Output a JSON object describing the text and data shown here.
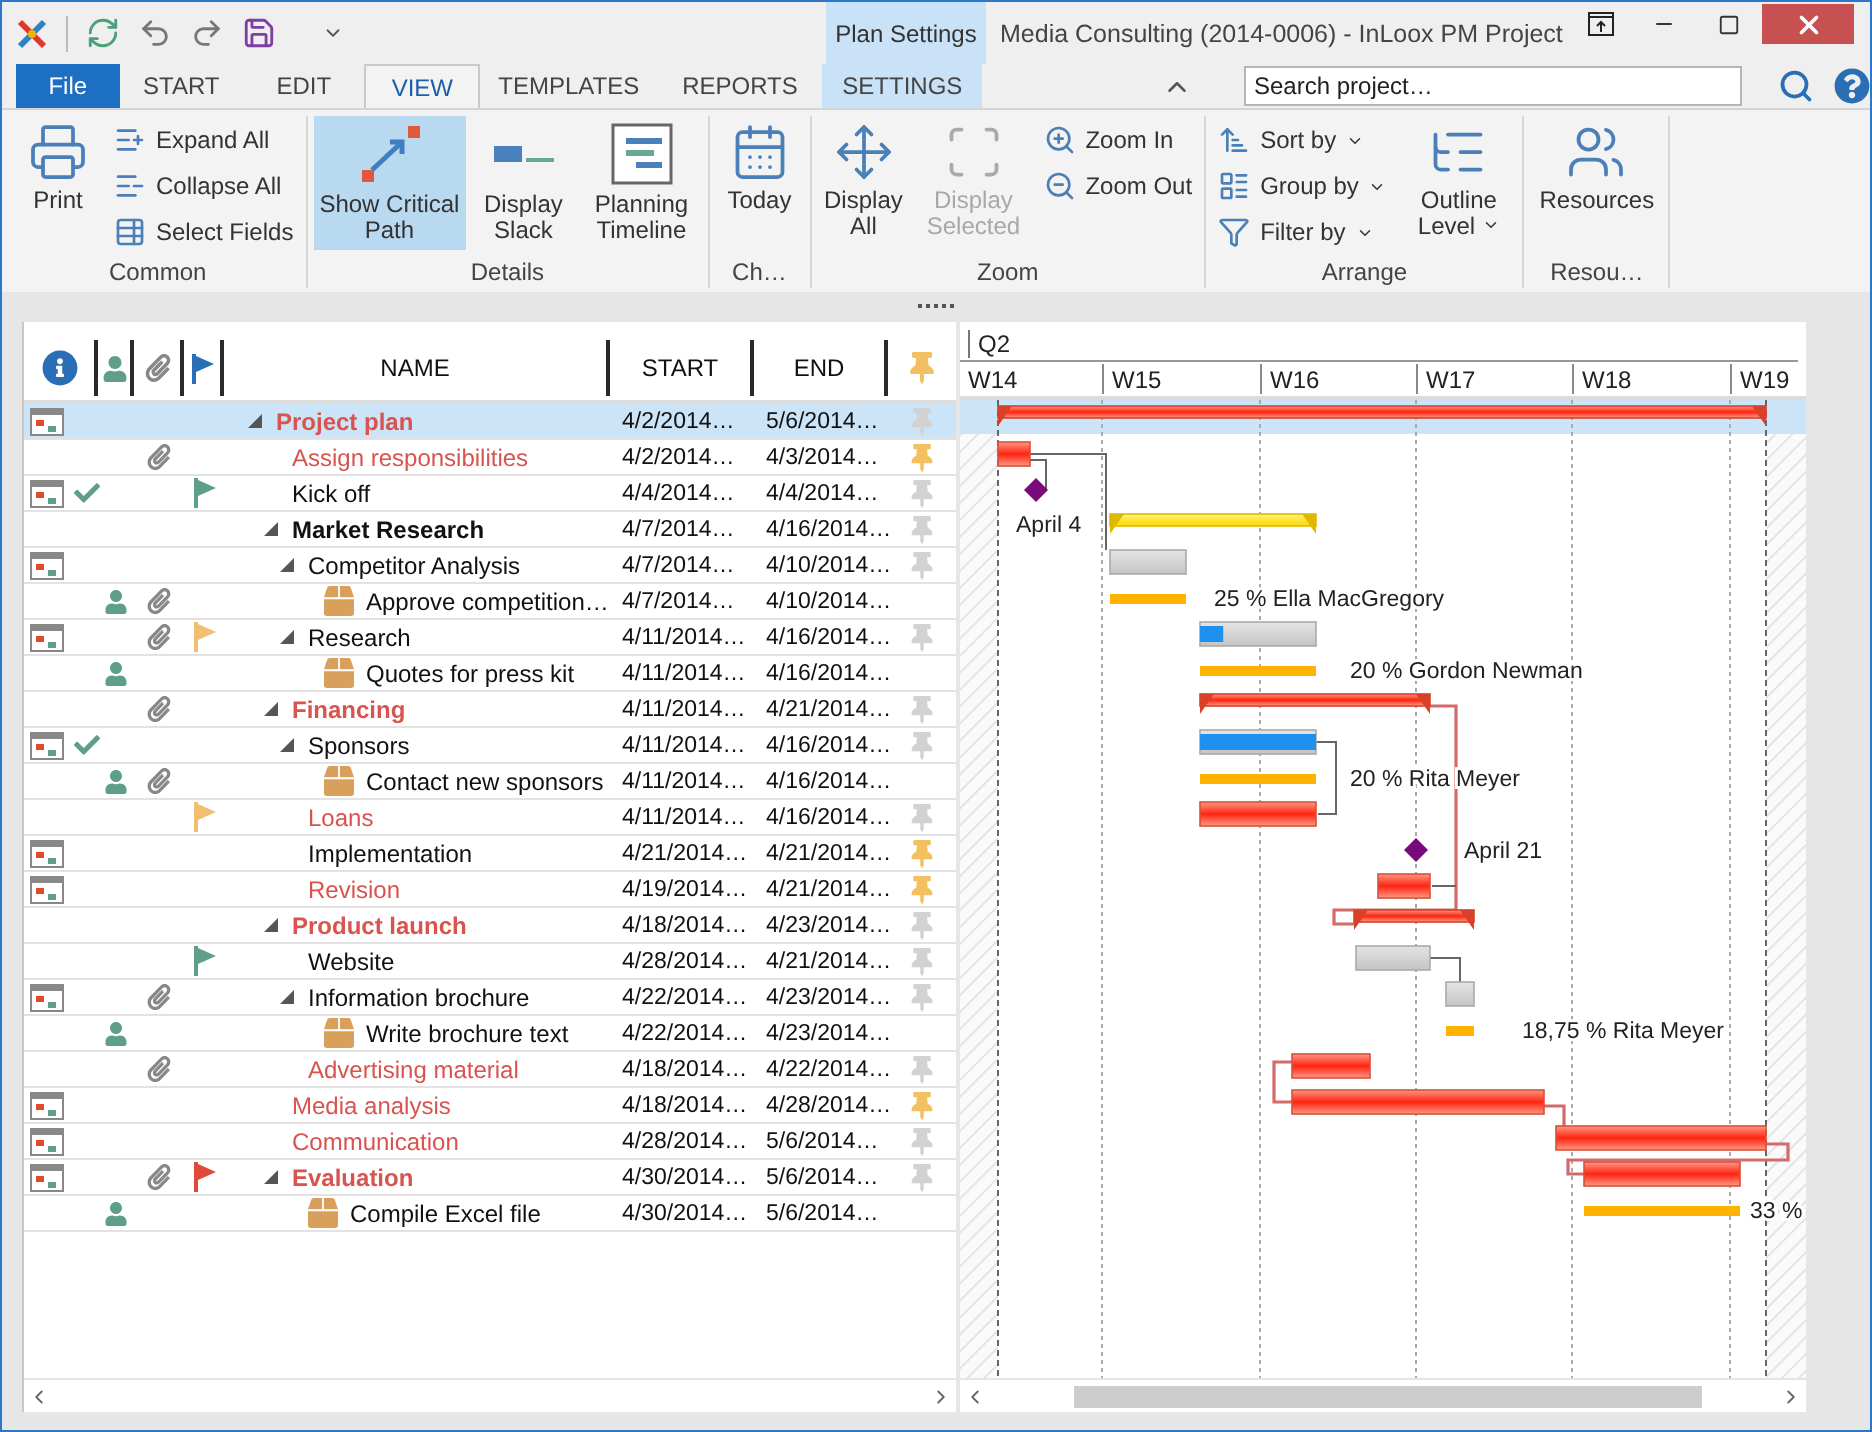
{
  "window": {
    "title": "Media Consulting (2014-0006) - InLoox PM Project",
    "context_header": "Plan Settings"
  },
  "tabs": [
    {
      "label": "File",
      "kind": "file",
      "selected": false
    },
    {
      "label": "START",
      "kind": "normal",
      "selected": false
    },
    {
      "label": "EDIT",
      "kind": "normal",
      "selected": false
    },
    {
      "label": "VIEW",
      "kind": "normal",
      "selected": true
    },
    {
      "label": "TEMPLATES",
      "kind": "normal",
      "selected": false
    },
    {
      "label": "REPORTS",
      "kind": "normal",
      "selected": false
    },
    {
      "label": "SETTINGS",
      "kind": "context",
      "selected": false
    }
  ],
  "search": {
    "placeholder": "Search project…"
  },
  "ribbon": {
    "groups": [
      {
        "label": "Common",
        "items": [
          {
            "label": "Print",
            "kind": "large",
            "selected": false,
            "disabled": false,
            "dropdown": false
          },
          {
            "label": "Expand All",
            "kind": "small",
            "selected": false,
            "disabled": false,
            "dropdown": false
          },
          {
            "label": "Collapse All",
            "kind": "small",
            "selected": false,
            "disabled": false,
            "dropdown": false
          },
          {
            "label": "Select Fields",
            "kind": "small",
            "selected": false,
            "disabled": false,
            "dropdown": false
          }
        ]
      },
      {
        "label": "Details",
        "items": [
          {
            "label": "Show Critical Path",
            "kind": "large",
            "selected": true,
            "disabled": false,
            "dropdown": false
          },
          {
            "label": "Display Slack",
            "kind": "large",
            "selected": false,
            "disabled": false,
            "dropdown": false
          },
          {
            "label": "Planning Timeline",
            "kind": "large",
            "selected": false,
            "disabled": false,
            "dropdown": false
          }
        ]
      },
      {
        "label": "Ch…",
        "items": [
          {
            "label": "Today",
            "kind": "large",
            "selected": false,
            "disabled": false,
            "dropdown": false
          }
        ]
      },
      {
        "label": "Zoom",
        "items": [
          {
            "label": "Display All",
            "kind": "large",
            "selected": false,
            "disabled": false,
            "dropdown": false
          },
          {
            "label": "Display Selected",
            "kind": "large",
            "selected": false,
            "disabled": true,
            "dropdown": false
          },
          {
            "label": "Zoom In",
            "kind": "small",
            "selected": false,
            "disabled": false,
            "dropdown": false
          },
          {
            "label": "Zoom Out",
            "kind": "small",
            "selected": false,
            "disabled": false,
            "dropdown": false
          }
        ]
      },
      {
        "label": "Arrange",
        "items": [
          {
            "label": "Sort by",
            "kind": "small",
            "selected": false,
            "disabled": false,
            "dropdown": true
          },
          {
            "label": "Group by",
            "kind": "small",
            "selected": false,
            "disabled": false,
            "dropdown": true
          },
          {
            "label": "Filter by",
            "kind": "small",
            "selected": false,
            "disabled": false,
            "dropdown": true
          },
          {
            "label": "Outline Level",
            "kind": "large",
            "selected": false,
            "disabled": false,
            "dropdown": true
          }
        ]
      },
      {
        "label": "Resou…",
        "items": [
          {
            "label": "Resources",
            "kind": "large",
            "selected": false,
            "disabled": false,
            "dropdown": false
          }
        ]
      }
    ]
  },
  "table": {
    "columns": [
      "NAME",
      "START",
      "END"
    ],
    "rows": [
      {
        "name": "Project plan",
        "kind": "task",
        "start": "4/2/2014…",
        "end": "5/6/2014…",
        "selected": true,
        "critical": true,
        "calendar": true,
        "done": false,
        "resource": false,
        "attachment": false,
        "expanded": true,
        "pinned": false,
        "children": [
          {
            "name": "Assign responsibilities",
            "kind": "task",
            "start": "4/2/2014…",
            "end": "4/3/2014…",
            "selected": false,
            "critical": true,
            "calendar": false,
            "done": false,
            "resource": false,
            "attachment": true,
            "pinned": true
          },
          {
            "name": "Kick off",
            "kind": "task",
            "start": "4/4/2014…",
            "end": "4/4/2014…",
            "selected": false,
            "critical": false,
            "calendar": true,
            "done": true,
            "resource": false,
            "attachment": false,
            "flag": {
              "color": "#5f9f8a"
            },
            "pinned": false
          },
          {
            "name": "Market Research",
            "kind": "task",
            "start": "4/7/2014…",
            "end": "4/16/2014…",
            "selected": false,
            "critical": false,
            "calendar": false,
            "done": false,
            "resource": false,
            "attachment": false,
            "expanded": true,
            "pinned": false,
            "children": [
              {
                "name": "Competitor Analysis",
                "kind": "task",
                "start": "4/7/2014…",
                "end": "4/10/2014…",
                "selected": false,
                "critical": false,
                "calendar": true,
                "done": false,
                "resource": false,
                "attachment": false,
                "expanded": true,
                "pinned": false,
                "children": [
                  {
                    "name": "Approve competition…",
                    "kind": "package",
                    "start": "4/7/2014…",
                    "end": "4/10/2014…",
                    "selected": false,
                    "critical": false,
                    "calendar": false,
                    "done": false,
                    "resource": true,
                    "attachment": true
                  }
                ]
              },
              {
                "name": "Research",
                "kind": "task",
                "start": "4/11/2014…",
                "end": "4/16/2014…",
                "selected": false,
                "critical": false,
                "calendar": true,
                "done": false,
                "resource": false,
                "attachment": true,
                "flag": {
                  "color": "#f0c070"
                },
                "expanded": true,
                "pinned": false,
                "children": [
                  {
                    "name": "Quotes for press kit",
                    "kind": "package",
                    "start": "4/11/2014…",
                    "end": "4/16/2014…",
                    "selected": false,
                    "critical": false,
                    "calendar": false,
                    "done": false,
                    "resource": true,
                    "attachment": false
                  }
                ]
              }
            ]
          },
          {
            "name": "Financing",
            "kind": "task",
            "start": "4/11/2014…",
            "end": "4/21/2014…",
            "selected": false,
            "critical": true,
            "calendar": false,
            "done": false,
            "resource": false,
            "attachment": true,
            "expanded": true,
            "pinned": false,
            "children": [
              {
                "name": "Sponsors",
                "kind": "task",
                "start": "4/11/2014…",
                "end": "4/16/2014…",
                "selected": false,
                "critical": false,
                "calendar": true,
                "done": true,
                "resource": false,
                "attachment": false,
                "expanded": true,
                "pinned": false,
                "children": [
                  {
                    "name": "Contact new sponsors",
                    "kind": "package",
                    "start": "4/11/2014…",
                    "end": "4/16/2014…",
                    "selected": false,
                    "critical": false,
                    "calendar": false,
                    "done": false,
                    "resource": true,
                    "attachment": true
                  }
                ]
              },
              {
                "name": "Loans",
                "kind": "task",
                "start": "4/11/2014…",
                "end": "4/16/2014…",
                "selected": false,
                "critical": true,
                "calendar": false,
                "done": false,
                "resource": false,
                "attachment": false,
                "flag": {
                  "color": "#f0c070"
                },
                "pinned": false
              },
              {
                "name": "Implementation",
                "kind": "task",
                "start": "4/21/2014…",
                "end": "4/21/2014…",
                "selected": false,
                "critical": false,
                "calendar": true,
                "done": false,
                "resource": false,
                "attachment": false,
                "pinned": true
              },
              {
                "name": "Revision",
                "kind": "task",
                "start": "4/19/2014…",
                "end": "4/21/2014…",
                "selected": false,
                "critical": true,
                "calendar": true,
                "done": false,
                "resource": false,
                "attachment": false,
                "pinned": true
              }
            ]
          },
          {
            "name": "Product launch",
            "kind": "task",
            "start": "4/18/2014…",
            "end": "4/23/2014…",
            "selected": false,
            "critical": true,
            "calendar": false,
            "done": false,
            "resource": false,
            "attachment": false,
            "expanded": true,
            "pinned": false,
            "children": [
              {
                "name": "Website",
                "kind": "task",
                "start": "4/28/2014…",
                "end": "4/21/2014…",
                "selected": false,
                "critical": false,
                "calendar": false,
                "done": false,
                "resource": false,
                "attachment": false,
                "flag": {
                  "color": "#5f9f8a"
                },
                "pinned": false
              },
              {
                "name": "Information brochure",
                "kind": "task",
                "start": "4/22/2014…",
                "end": "4/23/2014…",
                "selected": false,
                "critical": false,
                "calendar": true,
                "done": false,
                "resource": false,
                "attachment": true,
                "expanded": true,
                "pinned": false,
                "children": [
                  {
                    "name": "Write brochure text",
                    "kind": "package",
                    "start": "4/22/2014…",
                    "end": "4/23/2014…",
                    "selected": false,
                    "critical": false,
                    "calendar": false,
                    "done": false,
                    "resource": true,
                    "attachment": false
                  }
                ]
              },
              {
                "name": "Advertising material",
                "kind": "task",
                "start": "4/18/2014…",
                "end": "4/22/2014…",
                "selected": false,
                "critical": true,
                "calendar": false,
                "done": false,
                "resource": false,
                "attachment": true,
                "pinned": false
              }
            ]
          },
          {
            "name": "Media analysis",
            "kind": "task",
            "start": "4/18/2014…",
            "end": "4/28/2014…",
            "selected": false,
            "critical": true,
            "calendar": true,
            "done": false,
            "resource": false,
            "attachment": false,
            "pinned": true
          },
          {
            "name": "Communication",
            "kind": "task",
            "start": "4/28/2014…",
            "end": "5/6/2014…",
            "selected": false,
            "critical": true,
            "calendar": true,
            "done": false,
            "resource": false,
            "attachment": false,
            "pinned": false
          },
          {
            "name": "Evaluation",
            "kind": "task",
            "start": "4/30/2014…",
            "end": "5/6/2014…",
            "selected": false,
            "critical": true,
            "calendar": true,
            "done": false,
            "resource": false,
            "attachment": true,
            "flag": {
              "color": "#e04a3a"
            },
            "expanded": true,
            "pinned": false,
            "children": [
              {
                "name": "Compile Excel file",
                "kind": "package",
                "start": "4/30/2014…",
                "end": "5/6/2014…",
                "selected": false,
                "critical": false,
                "calendar": false,
                "done": false,
                "resource": true,
                "attachment": false
              }
            ]
          }
        ]
      }
    ]
  },
  "gantt": {
    "quarter": "Q2",
    "weeks": [
      "W14",
      "W15",
      "W16",
      "W17",
      "W18",
      "W19"
    ],
    "bars": [
      {
        "kind": "critical-summary"
      },
      {
        "kind": "critical"
      },
      {
        "kind": "milestone",
        "label": "April 4"
      },
      {
        "kind": "summary"
      },
      {
        "kind": "task"
      },
      {
        "kind": "allocation",
        "label": "25 % Ella MacGregory"
      },
      {
        "kind": "task",
        "level": 0.2
      },
      {
        "kind": "allocation",
        "label": "20 % Gordon Newman"
      },
      {
        "kind": "critical-summary"
      },
      {
        "kind": "task",
        "level": 1
      },
      {
        "kind": "allocation",
        "label": "20 % Rita Meyer"
      },
      {
        "kind": "critical"
      },
      {
        "kind": "milestone",
        "label": "April 21"
      },
      {
        "kind": "critical"
      },
      {
        "kind": "critical-summary"
      },
      {
        "kind": "task"
      },
      {
        "kind": "task"
      },
      {
        "kind": "allocation",
        "label": "18,75 % Rita Meyer"
      },
      {
        "kind": "critical"
      },
      {
        "kind": "critical"
      },
      {
        "kind": "critical"
      },
      {
        "kind": "critical"
      },
      {
        "kind": "allocation",
        "label": "33 %"
      }
    ]
  }
}
